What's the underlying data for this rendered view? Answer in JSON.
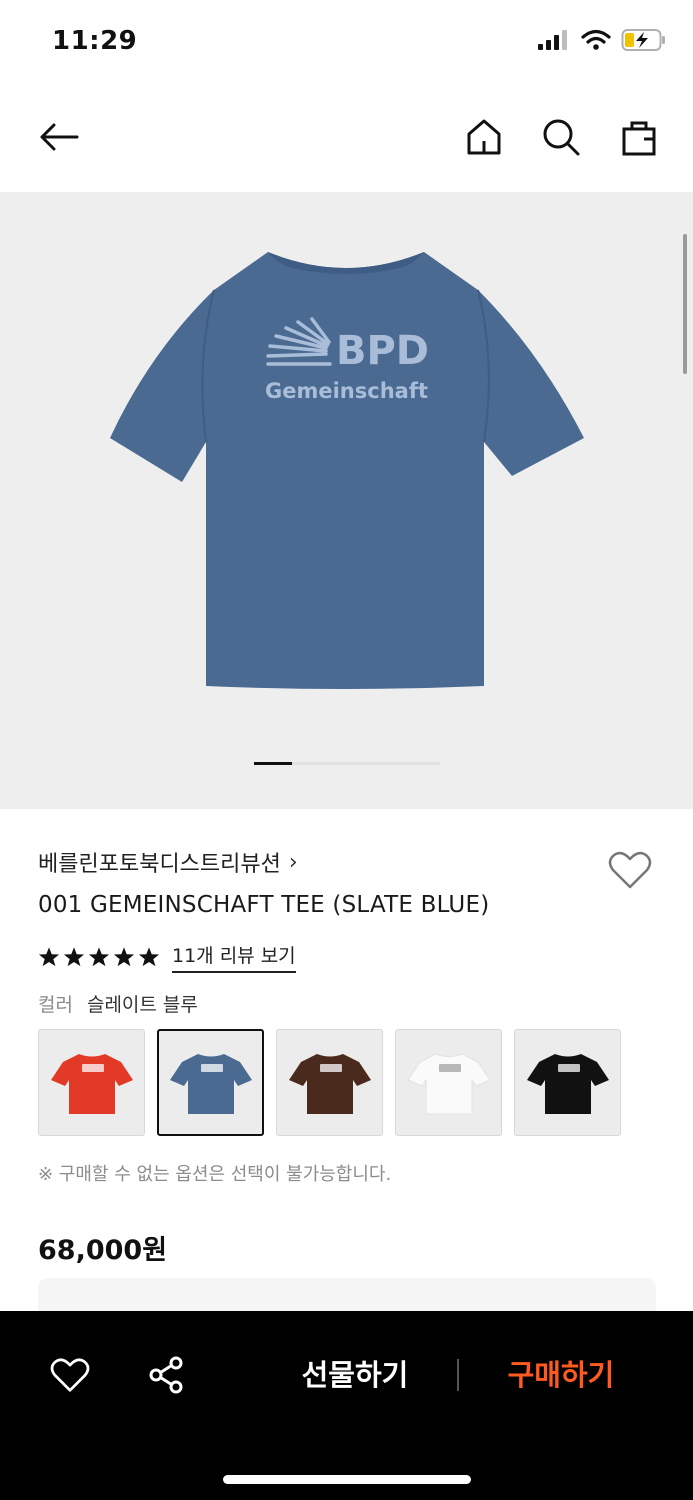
{
  "status": {
    "time": "11:29"
  },
  "nav": {
    "back_icon": "arrow-left-icon",
    "home_icon": "home-icon",
    "search_icon": "search-icon",
    "cart_icon": "shopping-bag-icon"
  },
  "hero": {
    "print_line1": "BPD",
    "print_line2": "Gemeinschaft",
    "tee_color": "#4a6a92",
    "print_color": "#a9bdd8",
    "active_slide_index": 0
  },
  "product": {
    "brand": "베를린포토북디스트리뷰션",
    "brand_chevron": "›",
    "title": "001 GEMEINSCHAFT TEE (SLATE BLUE)",
    "rating_stars": 5,
    "review_link": "11개 리뷰 보기",
    "color_label": "컬러",
    "color_value": "슬레이트 블루",
    "swatches": [
      {
        "name": "red",
        "color": "#e23a26",
        "selected": false
      },
      {
        "name": "slate blue",
        "color": "#4a6a92",
        "selected": true
      },
      {
        "name": "brown",
        "color": "#4a2a1c",
        "selected": false
      },
      {
        "name": "white",
        "color": "#fafafa",
        "selected": false
      },
      {
        "name": "black",
        "color": "#111111",
        "selected": false
      }
    ],
    "notice": "※ 구매할 수 없는 옵션은 선택이 불가능합니다.",
    "price": "68,000원"
  },
  "bottom_bar": {
    "gift_label": "선물하기",
    "buy_label": "구매하기",
    "like_icon": "heart-icon",
    "share_icon": "share-icon"
  },
  "colors": {
    "accent": "#ff5a1f",
    "bar_bg": "#000000"
  }
}
